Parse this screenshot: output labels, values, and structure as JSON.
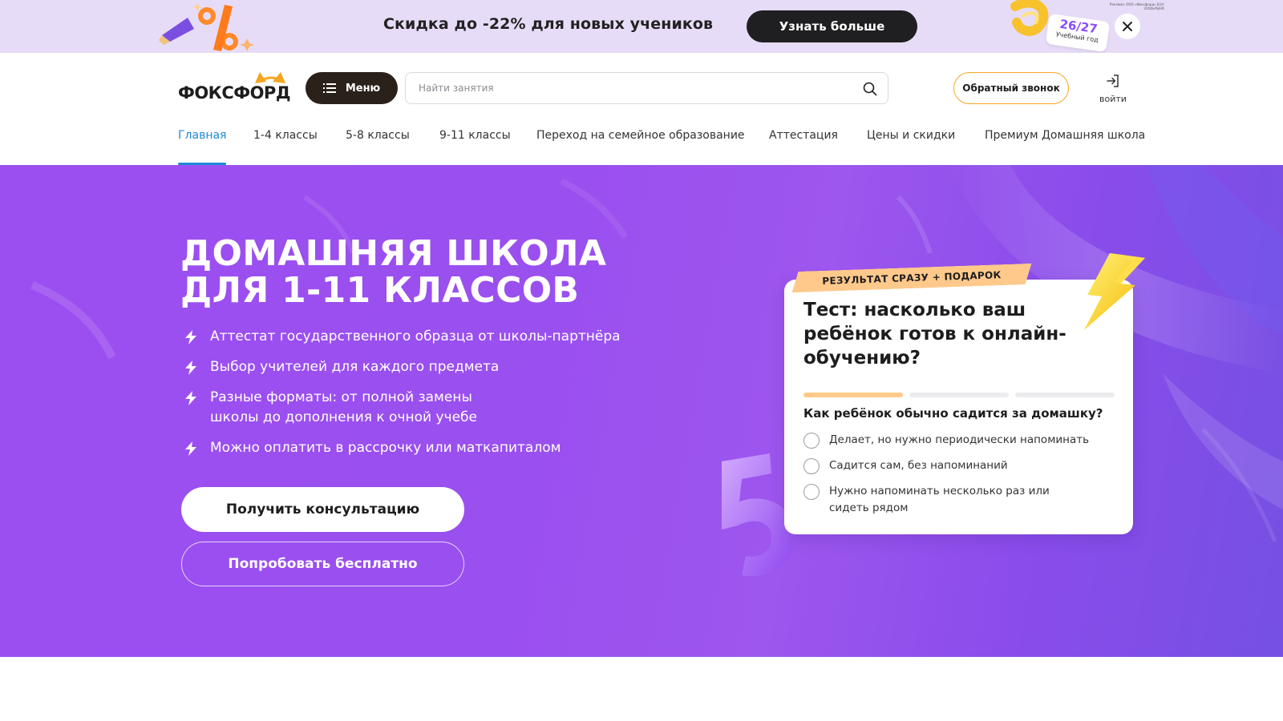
{
  "promo": {
    "text": "Скидка до -22% для новых учеников",
    "button_label": "Узнать больше",
    "year_number": "26/27",
    "year_caption": "Учебный год",
    "legal_text": "Реклама. ООО «Фоксфорд» Erid: 2VtzbxPyEAt"
  },
  "header": {
    "logo_text": "ФОКСФОРД",
    "menu_label": "Меню",
    "search_placeholder": "Найти занятия",
    "callback_label": "Обратный звонок",
    "login_label": "войти"
  },
  "nav": {
    "items": [
      {
        "label": "Главная",
        "active": true
      },
      {
        "label": "1-4 классы"
      },
      {
        "label": "5-8 классы"
      },
      {
        "label": "9-11 классы"
      },
      {
        "label": "Переход на семейное образование"
      },
      {
        "label": "Аттестация"
      },
      {
        "label": "Цены и скидки"
      },
      {
        "label": "Премиум Домашняя школа"
      }
    ]
  },
  "hero": {
    "title_line1": "ДОМАШНЯЯ ШКОЛА",
    "title_line2": "ДЛЯ 1-11 КЛАССОВ",
    "features": [
      "Аттестат государственного образца от школы-партнёра",
      "Выбор учителей для каждого предмета",
      "Разные форматы: от полной замены школы до дополнения к очной учебе",
      "Можно оплатить в рассрочку или маткапиталом"
    ],
    "primary_button": "Получить консультацию",
    "secondary_button": "Попробовать бесплатно"
  },
  "quiz": {
    "badge": "РЕЗУЛЬТАТ СРАЗУ + ПОДАРОК",
    "title": "Тест: насколько ваш ребёнок готов к онлайн-обучению?",
    "progress_step": 1,
    "progress_total": 3,
    "question": "Как ребёнок обычно садится за домашку?",
    "options": [
      "Делает, но нужно периодически напоминать",
      "Садится сам, без напоминаний",
      "Нужно напоминать несколько раз или сидеть рядом"
    ]
  },
  "colors": {
    "accent_blue": "#1c8ad8",
    "hero_purple": "#9a4fef",
    "callback_border": "#f6a520",
    "badge": "#ffc98b",
    "dark_button": "#1f1f22"
  }
}
